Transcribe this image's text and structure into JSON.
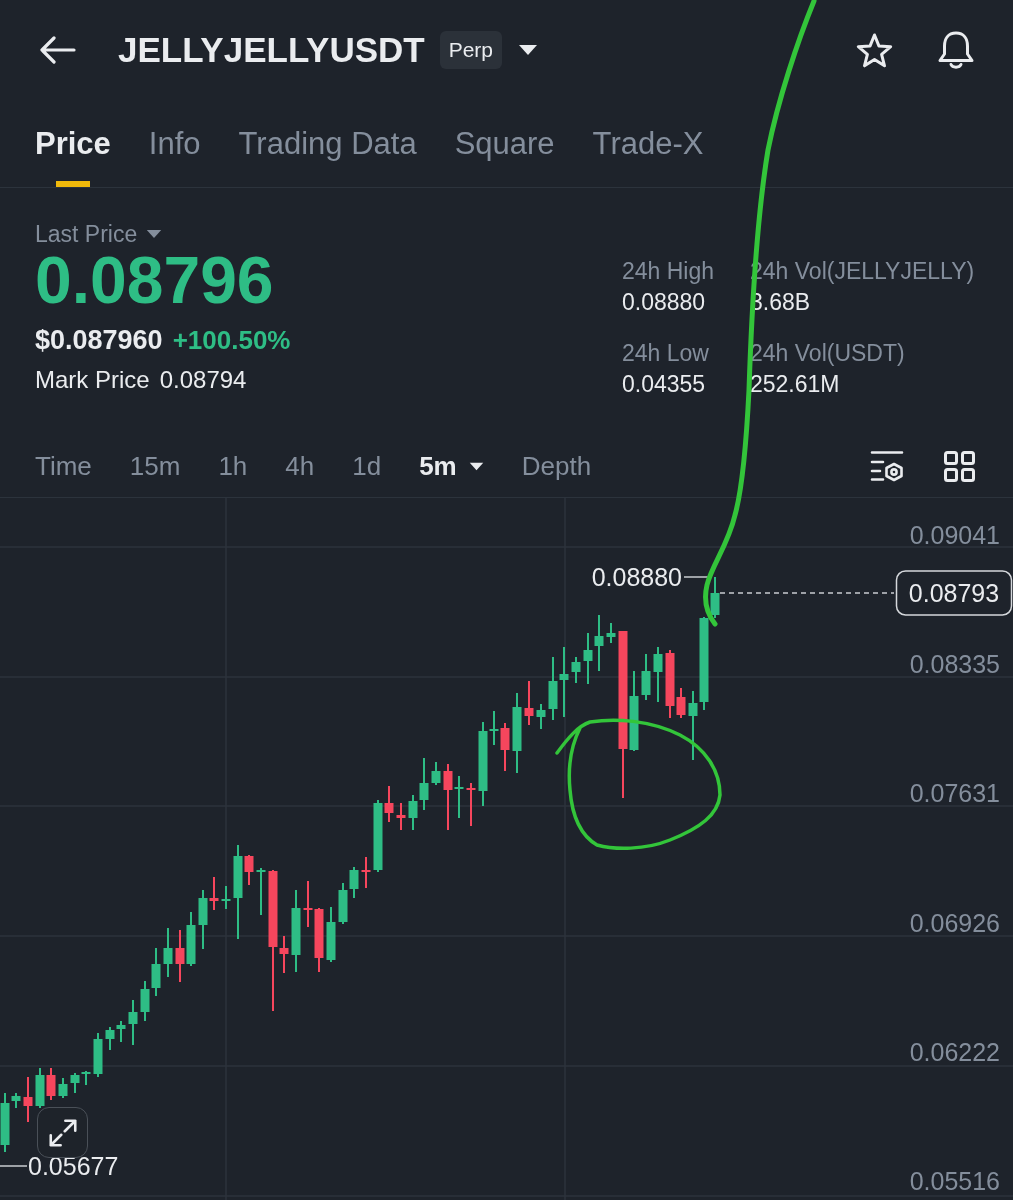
{
  "header": {
    "title": "JELLYJELLYUSDT",
    "badge": "Perp"
  },
  "tabs": [
    {
      "label": "Price",
      "selected": true
    },
    {
      "label": "Info",
      "selected": false
    },
    {
      "label": "Trading Data",
      "selected": false
    },
    {
      "label": "Square",
      "selected": false
    },
    {
      "label": "Trade-X",
      "selected": false
    }
  ],
  "ticker": {
    "last_price_label": "Last Price",
    "last_price": "0.08796",
    "fiat_price": "$0.087960",
    "change": "+100.50%",
    "mark_price_label": "Mark Price",
    "mark_price": "0.08794"
  },
  "stats": [
    {
      "label": "24h High",
      "value": "0.08880"
    },
    {
      "label": "24h Vol(JELLYJELLY)",
      "value": "3.68B"
    },
    {
      "label": "24h Low",
      "value": "0.04355"
    },
    {
      "label": "24h Vol(USDT)",
      "value": "252.61M"
    }
  ],
  "intervals": [
    {
      "label": "Time",
      "kind": "option",
      "selected": false
    },
    {
      "label": "15m",
      "kind": "option",
      "selected": false
    },
    {
      "label": "1h",
      "kind": "option",
      "selected": false
    },
    {
      "label": "4h",
      "kind": "option",
      "selected": false
    },
    {
      "label": "1d",
      "kind": "option",
      "selected": false
    },
    {
      "label": "5m",
      "kind": "dropdown",
      "selected": true
    },
    {
      "label": "Depth",
      "kind": "option",
      "selected": false
    }
  ],
  "chart": {
    "price_axis": [
      "0.09041",
      "0.08335",
      "0.07631",
      "0.06926",
      "0.06222",
      "0.05516"
    ],
    "high_label": "0.08880",
    "low_label": "0.05677",
    "current_price": "0.08793"
  },
  "annotations": [
    {
      "kind": "line"
    },
    {
      "kind": "circle"
    }
  ]
}
